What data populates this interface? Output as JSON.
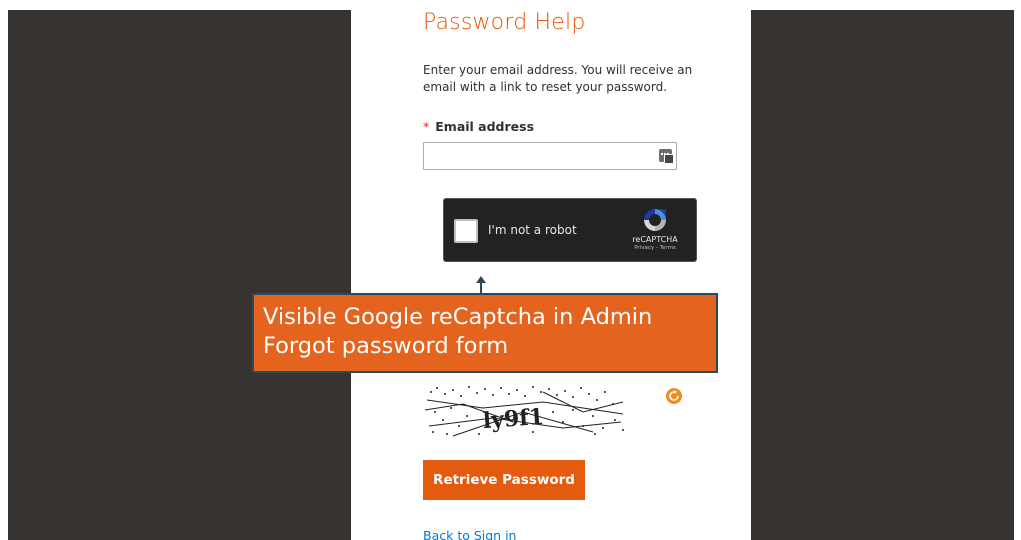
{
  "form": {
    "title": "Password Help",
    "description": "Enter your email address. You will receive an email with a link to reset your password.",
    "required_mark": "*",
    "email_label": "Email address",
    "email_value": "",
    "submit_label": "Retrieve Password",
    "back_link": "Back to Sign in"
  },
  "recaptcha": {
    "checkbox_label": "I'm not a robot",
    "brand": "reCAPTCHA",
    "privacy": "Privacy",
    "separator": " - ",
    "terms": "Terms",
    "icon": "recaptcha-logo"
  },
  "captcha_image": {
    "text": "ly9f1",
    "reload_icon": "reload-icon"
  },
  "callout": {
    "line1": "Visible Google reCaptcha in Admin",
    "line2": "Forgot password form"
  },
  "colors": {
    "accent": "#eb5202",
    "button": "#e45a0f",
    "callout": "#e3631f",
    "backdrop": "#373330",
    "link": "#007bdb"
  }
}
